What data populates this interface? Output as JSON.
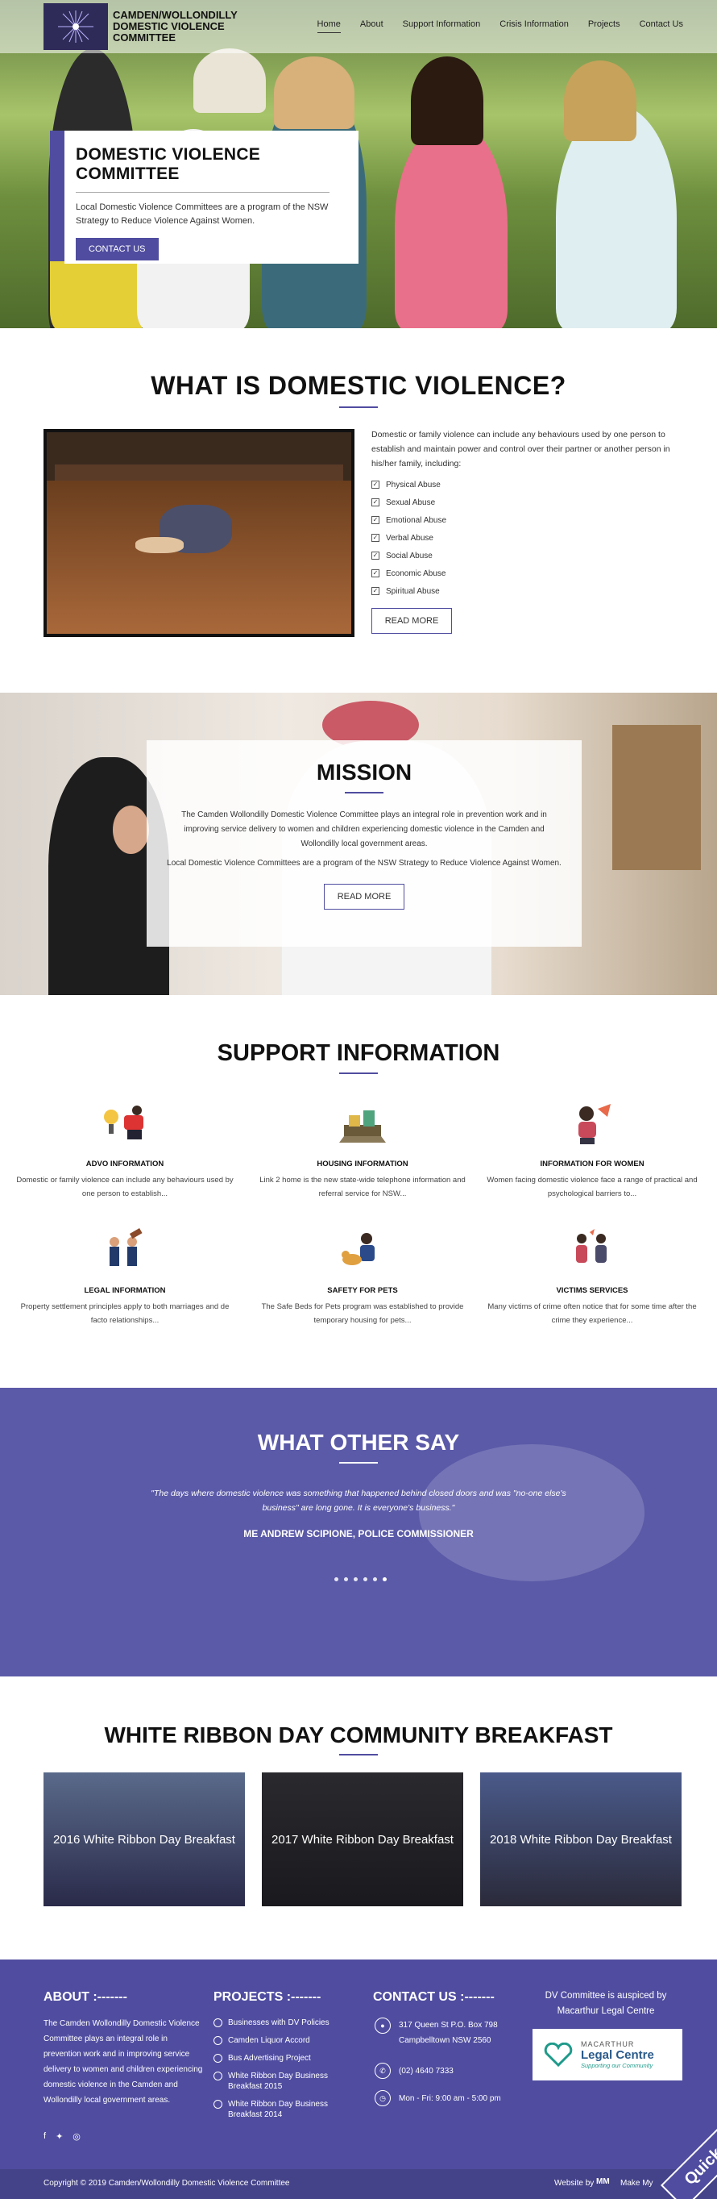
{
  "header": {
    "site_title": "CAMDEN/WOLLONDILLY DOMESTIC VIOLENCE COMMITTEE",
    "nav": [
      "Home",
      "About",
      "Support Information",
      "Crisis Information",
      "Projects",
      "Contact Us"
    ]
  },
  "hero": {
    "title": "DOMESTIC VIOLENCE COMMITTEE",
    "text": "Local Domestic Violence Committees are a program of the NSW Strategy to Reduce Violence Against Women.",
    "button": "CONTACT US"
  },
  "dv": {
    "title": "WHAT IS DOMESTIC VIOLENCE?",
    "intro": "Domestic or family violence can include any behaviours used by one person to establish and maintain power and control over their partner or another person in his/her family, including:",
    "items": [
      "Physical Abuse",
      "Sexual Abuse",
      "Emotional Abuse",
      "Verbal Abuse",
      "Social Abuse",
      "Economic Abuse",
      "Spiritual Abuse"
    ],
    "button": "READ MORE"
  },
  "mission": {
    "title": "MISSION",
    "p1": "The Camden Wollondilly Domestic Violence Committee plays an integral role in prevention work and in improving service delivery to women and children experiencing domestic violence in the Camden and Wollondilly local government areas.",
    "p2": "Local Domestic Violence Committees are a program of the NSW Strategy to Reduce Violence Against Women.",
    "button": "READ MORE"
  },
  "support": {
    "title": "SUPPORT INFORMATION",
    "items": [
      {
        "title": "ADVO INFORMATION",
        "text": "Domestic or family violence can include any behaviours used by one person to establish..."
      },
      {
        "title": "HOUSING INFORMATION",
        "text": "Link 2 home is the new state-wide telephone information and referral service for NSW..."
      },
      {
        "title": "INFORMATION FOR WOMEN",
        "text": "Women facing domestic violence face a range of practical and psychological barriers to..."
      },
      {
        "title": "LEGAL INFORMATION",
        "text": "Property settlement principles apply to both marriages and de facto relationships..."
      },
      {
        "title": "SAFETY FOR PETS",
        "text": "The Safe Beds for Pets program was established to provide temporary housing for pets..."
      },
      {
        "title": "VICTIMS SERVICES",
        "text": "Many victims of crime often notice that for some time after the crime they experience..."
      }
    ]
  },
  "testimonials": {
    "title": "WHAT OTHER SAY",
    "quote": "\"The days where domestic violence was something that happened behind closed doors and was \"no-one else's business\" are long gone. It is everyone's business.\"",
    "author": "ME ANDREW SCIPIONE, POLICE COMMISSIONER",
    "slide_count": 6,
    "active_slide": 5
  },
  "ribbon": {
    "title": "WHITE RIBBON DAY COMMUNITY BREAKFAST",
    "cards": [
      "2016 White Ribbon Day Breakfast",
      "2017 White Ribbon Day Breakfast",
      "2018 White Ribbon Day Breakfast"
    ]
  },
  "footer": {
    "about_title": "ABOUT  :-------",
    "about_text": "The Camden Wollondilly Domestic Violence Committee plays an integral role in prevention work and in improving service delivery to women and children experiencing domestic violence in the Camden and Wollondilly local government areas.",
    "projects_title": "PROJECTS  :-------",
    "projects": [
      "Businesses with DV Policies",
      "Camden Liquor Accord",
      "Bus Advertising Project",
      "White Ribbon Day Business Breakfast 2015",
      "White Ribbon Day Business Breakfast 2014"
    ],
    "contact_title": "CONTACT US  :-------",
    "address_line1": "317 Queen St P.O. Box 798",
    "address_line2": "Campbelltown NSW 2560",
    "phone": "(02) 4640 7333",
    "hours": "Mon - Fri: 9:00 am - 5:00 pm",
    "auspice": "DV Committee is auspiced by Macarthur Legal Centre",
    "partner_line1": "MACARTHUR",
    "partner_line2": "Legal Centre",
    "partner_tagline": "Supporting our Community",
    "copyright": "Copyright © 2019 Camden/Wollondilly Domestic Violence Committee",
    "credit": "Website by",
    "credit_name": "Make My",
    "quick_exit": "Quick Exit"
  },
  "colors": {
    "brand": "#504da0",
    "footer_dark": "#444288",
    "text": "#333333"
  }
}
